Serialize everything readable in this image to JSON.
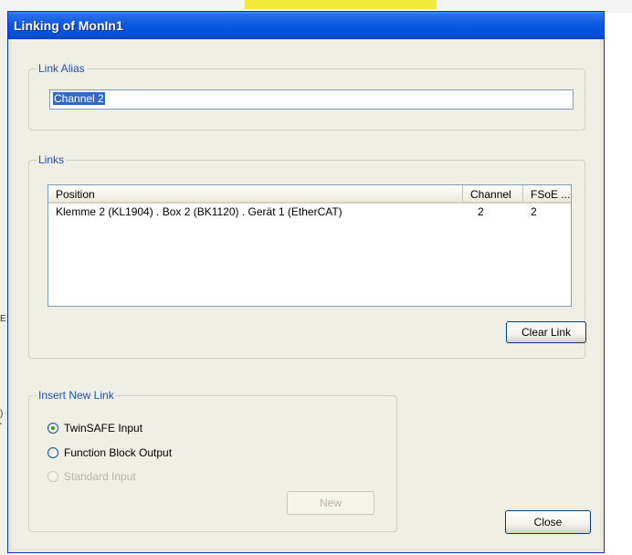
{
  "background": {
    "fragment_left": "E",
    "fragment_left2": ")",
    "fragment_left3": "'"
  },
  "dialog": {
    "title": "Linking of MonIn1"
  },
  "link_alias": {
    "group_label": "Link Alias",
    "value": "Channel 2"
  },
  "links": {
    "group_label": "Links",
    "columns": [
      "Position",
      "Channel",
      "FSoE ..."
    ],
    "rows": [
      {
        "position": "Klemme 2 (KL1904) . Box 2 (BK1120) . Gerät 1 (EtherCAT)",
        "channel": "2",
        "fsoe": "2"
      }
    ],
    "clear_label": "Clear Link"
  },
  "insert_new_link": {
    "group_label": "Insert New Link",
    "options": [
      {
        "label": "TwinSAFE Input",
        "checked": true,
        "enabled": true
      },
      {
        "label": "Function Block Output",
        "checked": false,
        "enabled": true
      },
      {
        "label": "Standard Input",
        "checked": false,
        "enabled": false
      }
    ],
    "new_label": "New"
  },
  "close_label": "Close",
  "colors": {
    "title_bar": "#0a56e0",
    "group_label": "#1f4fc4",
    "selection": "#316ac5",
    "dialog_bg": "#f0efe6"
  }
}
